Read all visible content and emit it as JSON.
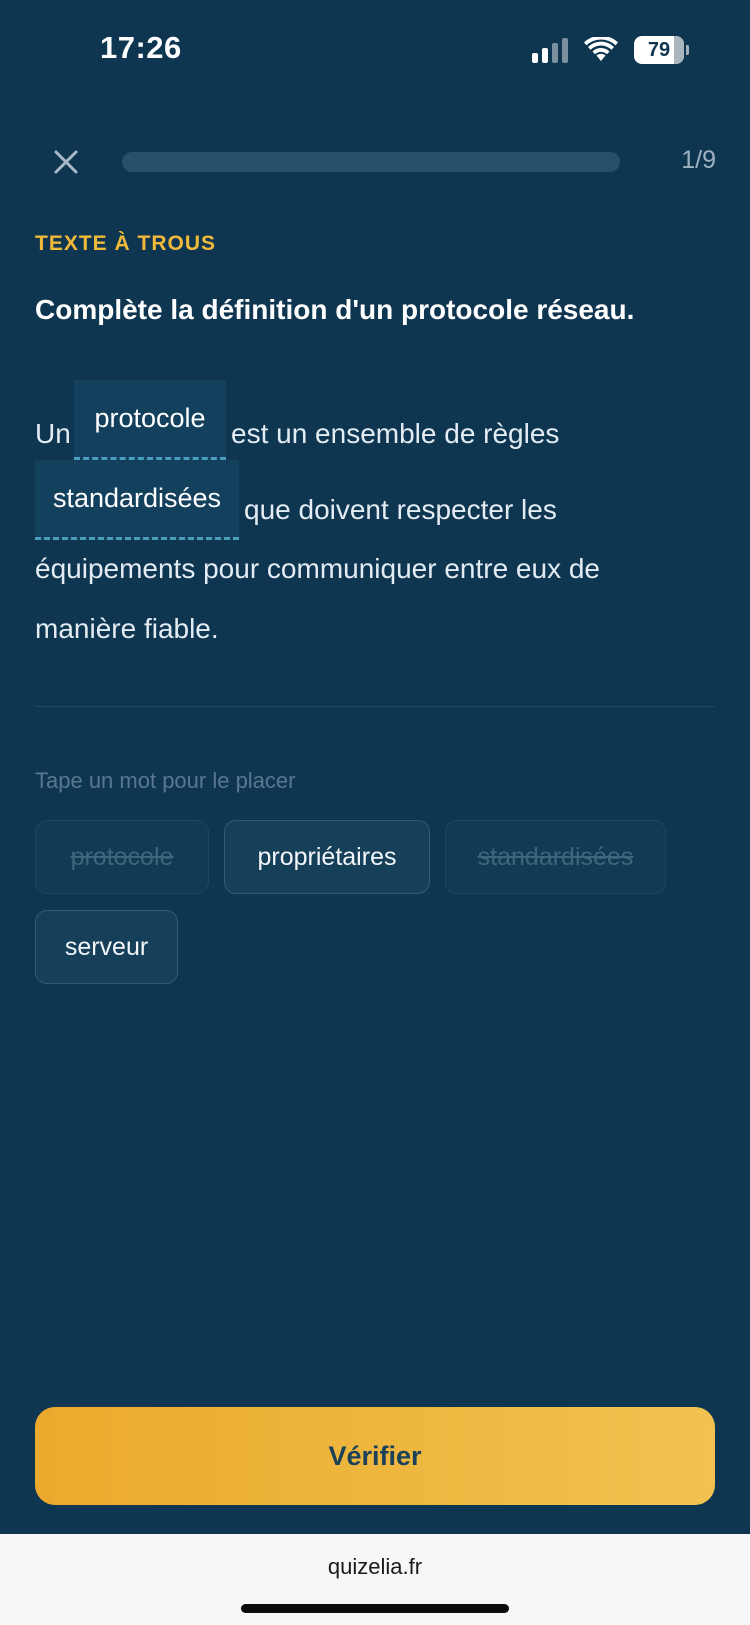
{
  "status_bar": {
    "time": "17:26",
    "battery": "79",
    "icons": [
      "cellular-signal-icon",
      "wifi-icon",
      "battery-icon"
    ]
  },
  "header": {
    "close_icon": "close-icon",
    "progress": {
      "current": 1,
      "total": 9,
      "fraction": 0.0
    },
    "progress_label": "1/9"
  },
  "exercise": {
    "type_label": "TEXTE À TROUS",
    "question": "Complète la définition d'un protocole réseau.",
    "passage": {
      "segment_1": "Un",
      "blank_1": "protocole",
      "segment_2": "est un ensemble de règles",
      "blank_2": "standardisées",
      "segment_3": "que doivent respecter les",
      "segment_4": "équipements pour communiquer entre eux de",
      "segment_5": "manière fiable."
    },
    "hint": "Tape un mot pour le placer",
    "choices": [
      {
        "label": "protocole",
        "used": true
      },
      {
        "label": "propriétaires",
        "used": false
      },
      {
        "label": "standardisées",
        "used": true
      },
      {
        "label": "serveur",
        "used": false
      }
    ]
  },
  "actions": {
    "verify_label": "Vérifier"
  },
  "browser": {
    "url": "quizelia.fr"
  },
  "colors": {
    "background": "#0f3651",
    "accent": "#f0b93a",
    "blank_underline": "#4c9ec0"
  }
}
